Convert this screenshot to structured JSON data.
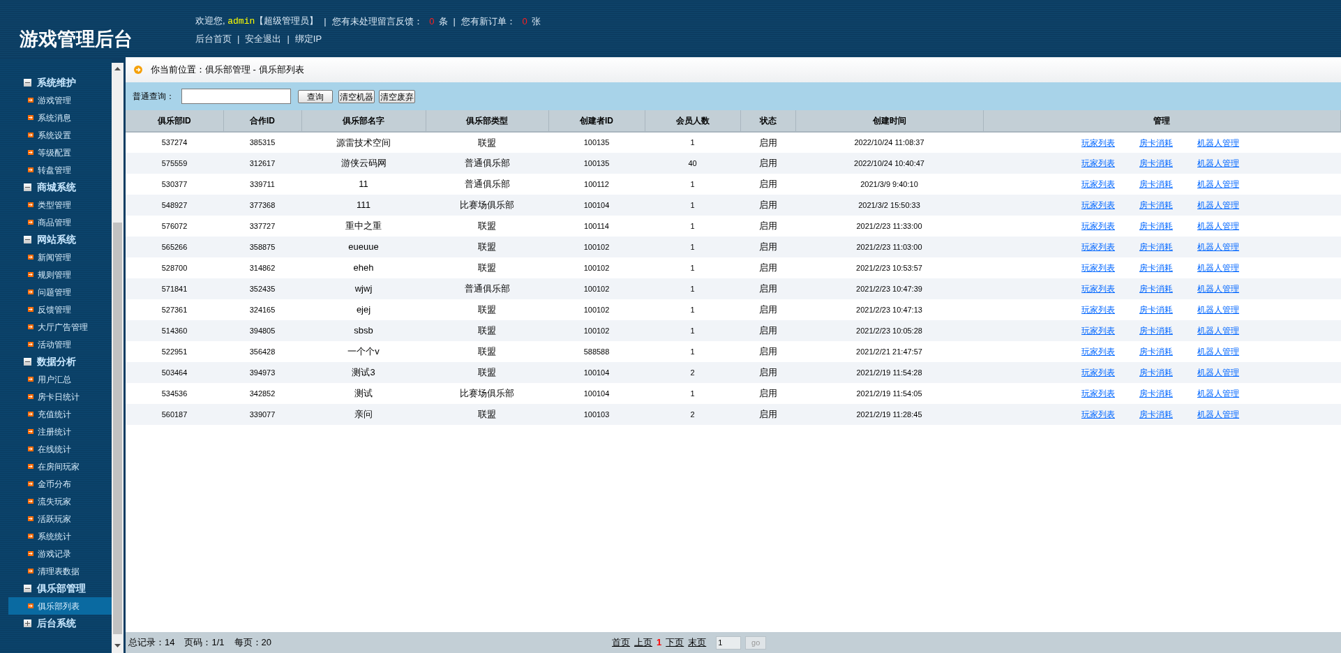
{
  "header": {
    "title": "游戏管理后台",
    "welcome": "欢迎您,",
    "user": "admin",
    "role": "【超级管理员】",
    "feedback_label": "您有未处理留言反馈：",
    "feedback_count": "0",
    "feedback_unit": "条",
    "orders_label": "您有新订单：",
    "orders_count": "0",
    "orders_unit": "张",
    "notice_separators": [
      "|",
      "|"
    ],
    "links": [
      "后台首页",
      "安全退出",
      "绑定IP"
    ],
    "link_separators": [
      "|",
      "|"
    ]
  },
  "sidebar": {
    "groups": [
      {
        "label": "系统维护",
        "expanded": true,
        "items": [
          {
            "label": "游戏管理",
            "selected": false
          },
          {
            "label": "系统消息",
            "selected": false
          },
          {
            "label": "系统设置",
            "selected": false
          },
          {
            "label": "等级配置",
            "selected": false
          },
          {
            "label": "转盘管理",
            "selected": false
          }
        ]
      },
      {
        "label": "商城系统",
        "expanded": true,
        "items": [
          {
            "label": "类型管理",
            "selected": false
          },
          {
            "label": "商品管理",
            "selected": false
          }
        ]
      },
      {
        "label": "网站系统",
        "expanded": true,
        "items": [
          {
            "label": "新闻管理",
            "selected": false
          },
          {
            "label": "规则管理",
            "selected": false
          },
          {
            "label": "问题管理",
            "selected": false
          },
          {
            "label": "反馈管理",
            "selected": false
          },
          {
            "label": "大厅广告管理",
            "selected": false
          },
          {
            "label": "活动管理",
            "selected": false
          }
        ]
      },
      {
        "label": "数据分析",
        "expanded": true,
        "items": [
          {
            "label": "用户汇总",
            "selected": false
          },
          {
            "label": "房卡日统计",
            "selected": false
          },
          {
            "label": "充值统计",
            "selected": false
          },
          {
            "label": "注册统计",
            "selected": false
          },
          {
            "label": "在线统计",
            "selected": false
          },
          {
            "label": "在房间玩家",
            "selected": false
          },
          {
            "label": "金币分布",
            "selected": false
          },
          {
            "label": "流失玩家",
            "selected": false
          },
          {
            "label": "活跃玩家",
            "selected": false
          },
          {
            "label": "系统统计",
            "selected": false
          },
          {
            "label": "游戏记录",
            "selected": false
          },
          {
            "label": "清理表数据",
            "selected": false
          }
        ]
      },
      {
        "label": "俱乐部管理",
        "expanded": true,
        "items": [
          {
            "label": "俱乐部列表",
            "selected": true
          }
        ]
      },
      {
        "label": "后台系统",
        "expanded": false
      }
    ]
  },
  "breadcrumb": "你当前位置：俱乐部管理 - 俱乐部列表",
  "search": {
    "label": "普通查询：",
    "buttons": [
      "查询",
      "清空机器",
      "清空废弃"
    ]
  },
  "table": {
    "columns": [
      "俱乐部ID",
      "合作ID",
      "俱乐部名字",
      "俱乐部类型",
      "创建者ID",
      "会员人数",
      "状态",
      "创建时间",
      "管理"
    ],
    "rows": [
      {
        "cells": [
          "537274",
          "385315",
          "源雷技术空间",
          "联盟",
          "100135",
          "1",
          "启用",
          "2022/10/24 11:08:37"
        ],
        "actions": [
          "玩家列表",
          "房卡消耗",
          "机器人管理"
        ]
      },
      {
        "cells": [
          "575559",
          "312617",
          "游侠云码网",
          "普通俱乐部",
          "100135",
          "40",
          "启用",
          "2022/10/24 10:40:47"
        ],
        "actions": [
          "玩家列表",
          "房卡消耗",
          "机器人管理"
        ]
      },
      {
        "cells": [
          "530377",
          "339711",
          "11",
          "普通俱乐部",
          "100112",
          "1",
          "启用",
          "2021/3/9 9:40:10"
        ],
        "actions": [
          "玩家列表",
          "房卡消耗",
          "机器人管理"
        ]
      },
      {
        "cells": [
          "548927",
          "377368",
          "111",
          "比赛场俱乐部",
          "100104",
          "1",
          "启用",
          "2021/3/2 15:50:33"
        ],
        "actions": [
          "玩家列表",
          "房卡消耗",
          "机器人管理"
        ]
      },
      {
        "cells": [
          "576072",
          "337727",
          "重中之重",
          "联盟",
          "100114",
          "1",
          "启用",
          "2021/2/23 11:33:00"
        ],
        "actions": [
          "玩家列表",
          "房卡消耗",
          "机器人管理"
        ]
      },
      {
        "cells": [
          "565266",
          "358875",
          "eueuue",
          "联盟",
          "100102",
          "1",
          "启用",
          "2021/2/23 11:03:00"
        ],
        "actions": [
          "玩家列表",
          "房卡消耗",
          "机器人管理"
        ]
      },
      {
        "cells": [
          "528700",
          "314862",
          "eheh",
          "联盟",
          "100102",
          "1",
          "启用",
          "2021/2/23 10:53:57"
        ],
        "actions": [
          "玩家列表",
          "房卡消耗",
          "机器人管理"
        ]
      },
      {
        "cells": [
          "571841",
          "352435",
          "wjwj",
          "普通俱乐部",
          "100102",
          "1",
          "启用",
          "2021/2/23 10:47:39"
        ],
        "actions": [
          "玩家列表",
          "房卡消耗",
          "机器人管理"
        ]
      },
      {
        "cells": [
          "527361",
          "324165",
          "ejej",
          "联盟",
          "100102",
          "1",
          "启用",
          "2021/2/23 10:47:13"
        ],
        "actions": [
          "玩家列表",
          "房卡消耗",
          "机器人管理"
        ]
      },
      {
        "cells": [
          "514360",
          "394805",
          "sbsb",
          "联盟",
          "100102",
          "1",
          "启用",
          "2021/2/23 10:05:28"
        ],
        "actions": [
          "玩家列表",
          "房卡消耗",
          "机器人管理"
        ]
      },
      {
        "cells": [
          "522951",
          "356428",
          "一个个v",
          "联盟",
          "588588",
          "1",
          "启用",
          "2021/2/21 21:47:57"
        ],
        "actions": [
          "玩家列表",
          "房卡消耗",
          "机器人管理"
        ]
      },
      {
        "cells": [
          "503464",
          "394973",
          "测试3",
          "联盟",
          "100104",
          "2",
          "启用",
          "2021/2/19 11:54:28"
        ],
        "actions": [
          "玩家列表",
          "房卡消耗",
          "机器人管理"
        ]
      },
      {
        "cells": [
          "534536",
          "342852",
          "测试",
          "比赛场俱乐部",
          "100104",
          "1",
          "启用",
          "2021/2/19 11:54:05"
        ],
        "actions": [
          "玩家列表",
          "房卡消耗",
          "机器人管理"
        ]
      },
      {
        "cells": [
          "560187",
          "339077",
          "亲问",
          "联盟",
          "100103",
          "2",
          "启用",
          "2021/2/19 11:28:45"
        ],
        "actions": [
          "玩家列表",
          "房卡消耗",
          "机器人管理"
        ]
      }
    ]
  },
  "footer": {
    "total": "总记录：14",
    "page": "页码：1/1",
    "per_page": "每页：20",
    "pager": [
      {
        "label": "首页",
        "current": false
      },
      {
        "label": "上页",
        "current": false
      },
      {
        "label": "1",
        "current": true
      },
      {
        "label": "下页",
        "current": false
      },
      {
        "label": "末页",
        "current": false
      }
    ],
    "page_input": "1",
    "go": "go"
  }
}
